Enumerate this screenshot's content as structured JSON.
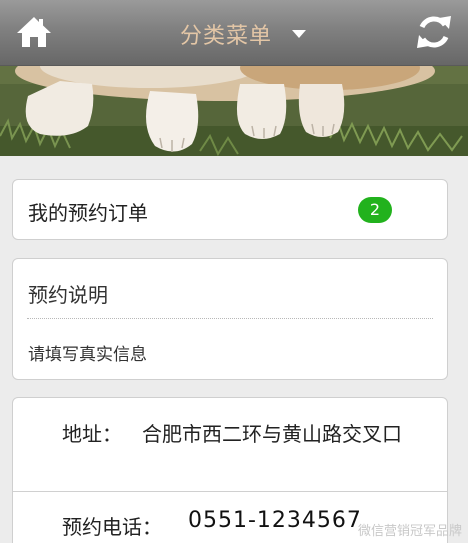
{
  "header": {
    "title": "分类菜单",
    "icons": {
      "home": "home-icon",
      "dropdown": "caret-down-icon",
      "refresh": "refresh-icon"
    },
    "colors": {
      "bar": "#808080",
      "title": "#e3c6a6"
    }
  },
  "orders": {
    "label": "我的预约订单",
    "count": "2",
    "badge_color": "#22b21d"
  },
  "notice": {
    "title": "预约说明",
    "text": "请填写真实信息"
  },
  "contact": {
    "address_label": "地址：",
    "address_value": "合肥市西二环与黄山路交叉口",
    "phone_label": "预约电话：",
    "phone_value": "0551-1234567"
  },
  "watermark": "微信营销冠军品牌"
}
